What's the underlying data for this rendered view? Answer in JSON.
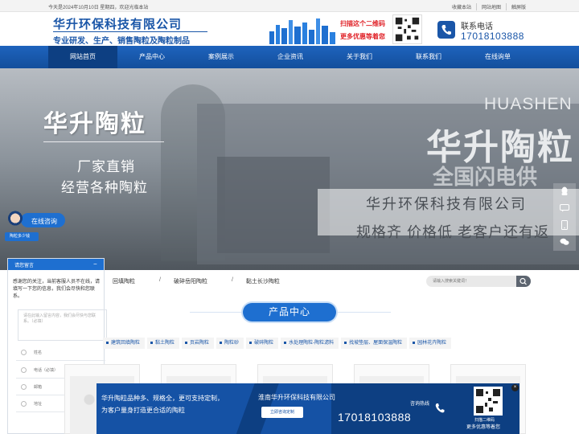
{
  "topbar": {
    "greeting": "今天是2024年10月10日 星期四，欢迎光临本站",
    "links": [
      "收藏本站",
      "网站地图",
      "触屏版"
    ]
  },
  "header": {
    "company": "华升环保科技有限公司",
    "slogan": "专业研发、生产、销售陶粒及陶粒制品",
    "scan_line1": "扫描这个二维码",
    "scan_line2": "更多优惠等着您",
    "phone_label": "联系电话",
    "phone_number": "17018103888"
  },
  "nav": {
    "items": [
      "网站首页",
      "产品中心",
      "案例展示",
      "企业资讯",
      "关于我们",
      "联系我们",
      "在线询单"
    ],
    "active_index": 0
  },
  "banner": {
    "title": "华升陶粒",
    "sub1": "厂家直销",
    "sub2": "经营各种陶粒",
    "english": "HUASHEN",
    "big": "华升陶粒",
    "gray": "全国闪电供",
    "company": "华升环保科技有限公司",
    "slogan": "规格齐 价格低 老客户还有返",
    "dots": [
      "1",
      "2",
      "3"
    ],
    "active_dot": 2
  },
  "consult": {
    "label": "在线咨询",
    "badge": "陶粒多少钱"
  },
  "chat": {
    "title": "请您留言",
    "minimize": "−",
    "message": "感谢您的关注，当前客服人员不在线，请填写一下您的信息，我们会尽快和您联系。",
    "textarea_placeholder": "请在此输入留言内容，我们会尽快与您联系。（必填）",
    "fields": [
      "姓名",
      "电话（必填）",
      "邮箱",
      "地址"
    ],
    "submit": "提交"
  },
  "tags": [
    "回填陶粒",
    "破碎岳阳陶粒",
    "黏土长沙陶粒"
  ],
  "search": {
    "placeholder": "请输入搜索关键词！"
  },
  "section": {
    "title": "产品中心"
  },
  "categories": [
    "建筑回填陶粒",
    "黏土陶粒",
    "页岩陶粒",
    "陶粒砂",
    "破碎陶粒",
    "水处理陶粒-陶粒滤料",
    "找坡垫层、屋面保温陶粒",
    "园林花卉陶粒"
  ],
  "promo": {
    "line1": "华升陶粒品种多、规格全，更可支持定制，",
    "line2": "为客户量身打造更合适的陶粒",
    "company": "淮南华升环保科技有限公司",
    "button": "立即咨询定制",
    "hotline_label": "咨询热线",
    "hotline": "17018103888",
    "qr_line1": "扫描二维码",
    "qr_line2": "更多优惠等着您",
    "close": "×"
  },
  "icons": {
    "phone": "phone-icon",
    "search": "search-icon",
    "qq": "qq-icon",
    "mobile": "mobile-icon",
    "wechat": "wechat-icon",
    "back_top": "arrow-up-icon"
  },
  "colors": {
    "brand_blue": "#1a56a8",
    "nav_blue": "#1e63bd",
    "accent_red": "#e0242a"
  }
}
